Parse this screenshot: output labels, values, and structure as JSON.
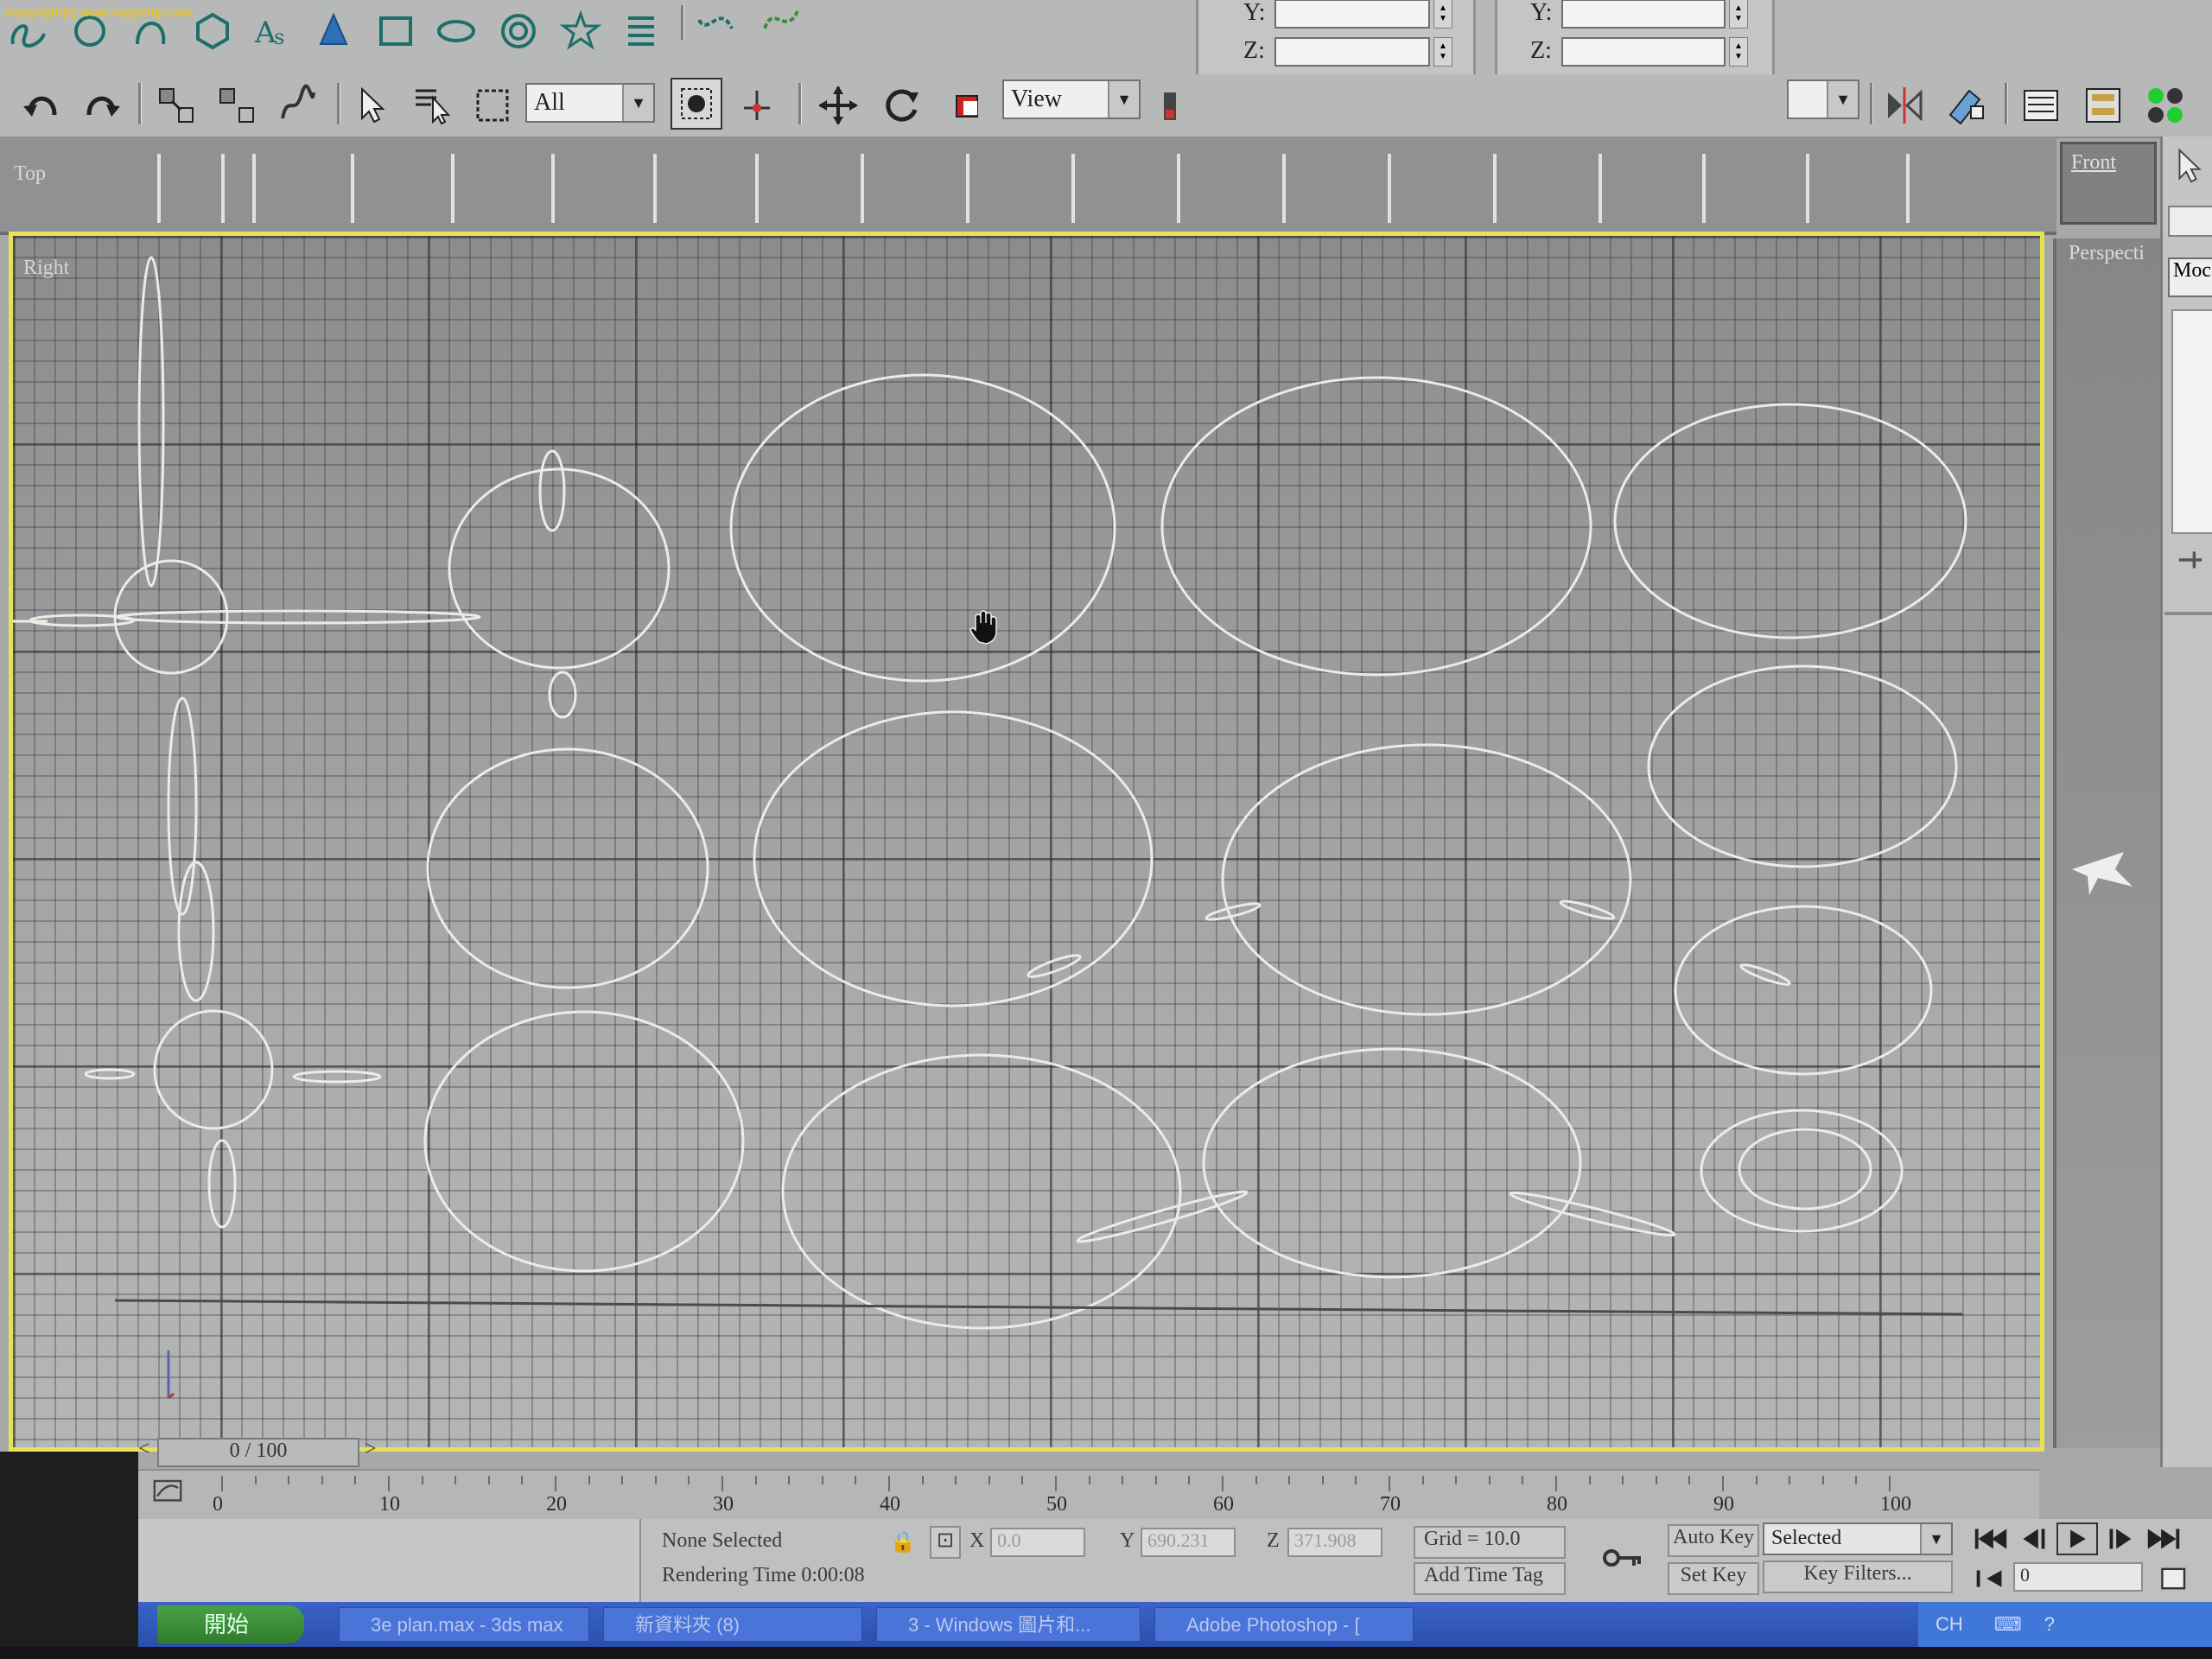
{
  "copyright": "Copyright(c) www.copyship.com",
  "toolbar": {
    "selection_filter": "All",
    "reference_coord": "View",
    "right_dropdown": ""
  },
  "coords_left": {
    "y_label": "Y:",
    "z_label": "Z:"
  },
  "coords_right": {
    "y_label": "Y:",
    "z_label": "Z:"
  },
  "viewports": {
    "top": "Top",
    "right": "Right",
    "front": "Front",
    "perspective": "Perspecti"
  },
  "command_panel": {
    "tab_label": "Moc"
  },
  "time_slider": {
    "frame": "0 / 100",
    "prev": "<",
    "next": ">"
  },
  "track": {
    "ticks": [
      "0",
      "10",
      "20",
      "30",
      "40",
      "50",
      "60",
      "70",
      "80",
      "90",
      "100"
    ]
  },
  "status": {
    "selection": "None Selected",
    "render_time": "Rendering Time  0:00:08",
    "x_label": "X",
    "x_value": "0.0",
    "y_label": "Y",
    "y_value": "690.231",
    "z_label": "Z",
    "z_value": "371.908",
    "grid": "Grid = 10.0",
    "add_time_tag": "Add Time Tag",
    "auto_key": "Auto Key",
    "set_key": "Set Key",
    "key_mode": "Selected",
    "key_filters": "Key Filters...",
    "frame_value": "0"
  },
  "taskbar": {
    "start": "開始",
    "items": [
      "3e plan.max - 3ds max",
      "新資料夾 (8)",
      "3 - Windows 圖片和...",
      "Adobe Photoshop - ["
    ],
    "tray": "CH"
  },
  "colors": {
    "viewport_border_active": "#e9e05a",
    "spline_color": "#eceae6",
    "toolbar_bg": "#b7b9b8"
  }
}
